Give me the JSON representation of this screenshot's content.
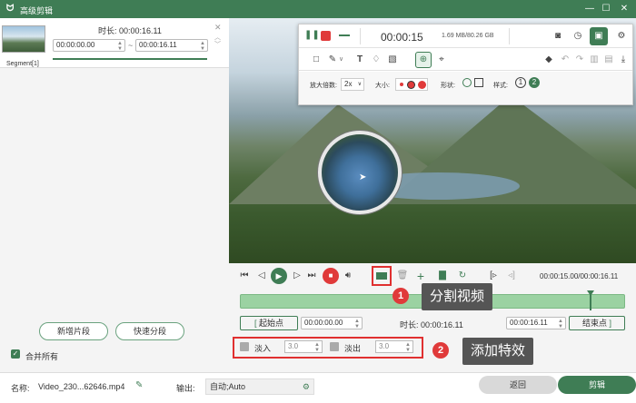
{
  "window": {
    "title": "高级剪辑",
    "logo_glyph": "ᗢ",
    "controls": {
      "minimize": "—",
      "maximize": "☐",
      "close": "✕"
    }
  },
  "segment": {
    "label": "Segment[1]",
    "duration_label": "时长: 00:00:16.11",
    "start": "00:00:00.00",
    "separator": "~",
    "end": "00:00:16.11"
  },
  "left_buttons": {
    "add_segment": "新增片段",
    "quick_split": "快速分段"
  },
  "merge": {
    "label": "合并所有",
    "checked": true
  },
  "recorder": {
    "time": "00:00:15",
    "size": "1.69 MB/80.26 GB",
    "zoom_label": "放大倍数:",
    "zoom_value": "2x",
    "size_label": "大小:",
    "shape_label": "形状:",
    "style_label": "样式:",
    "style_options": [
      "1",
      "2"
    ]
  },
  "playback": {
    "time": "00:00:15.00/00:00:16.11"
  },
  "range": {
    "start_btn": "起始点",
    "start_value": "00:00:00.00",
    "duration": "时长: 00:00:16.11",
    "end_value": "00:00:16.11",
    "end_btn": "结束点"
  },
  "effects": {
    "fade_in_label": "淡入",
    "fade_in_value": "3.0",
    "fade_out_label": "淡出",
    "fade_out_value": "3.0"
  },
  "annotations": [
    {
      "number": "1",
      "text": "分割视频"
    },
    {
      "number": "2",
      "text": "添加特效"
    }
  ],
  "footer": {
    "name_label": "名称:",
    "name_value": "Video_230...62646.mp4",
    "output_label": "输出:",
    "output_value": "自动;Auto",
    "back": "返回",
    "cut": "剪辑"
  },
  "colors": {
    "accent": "#3f7d55",
    "danger": "#e03a3a",
    "timeline": "#9bd2a2"
  }
}
